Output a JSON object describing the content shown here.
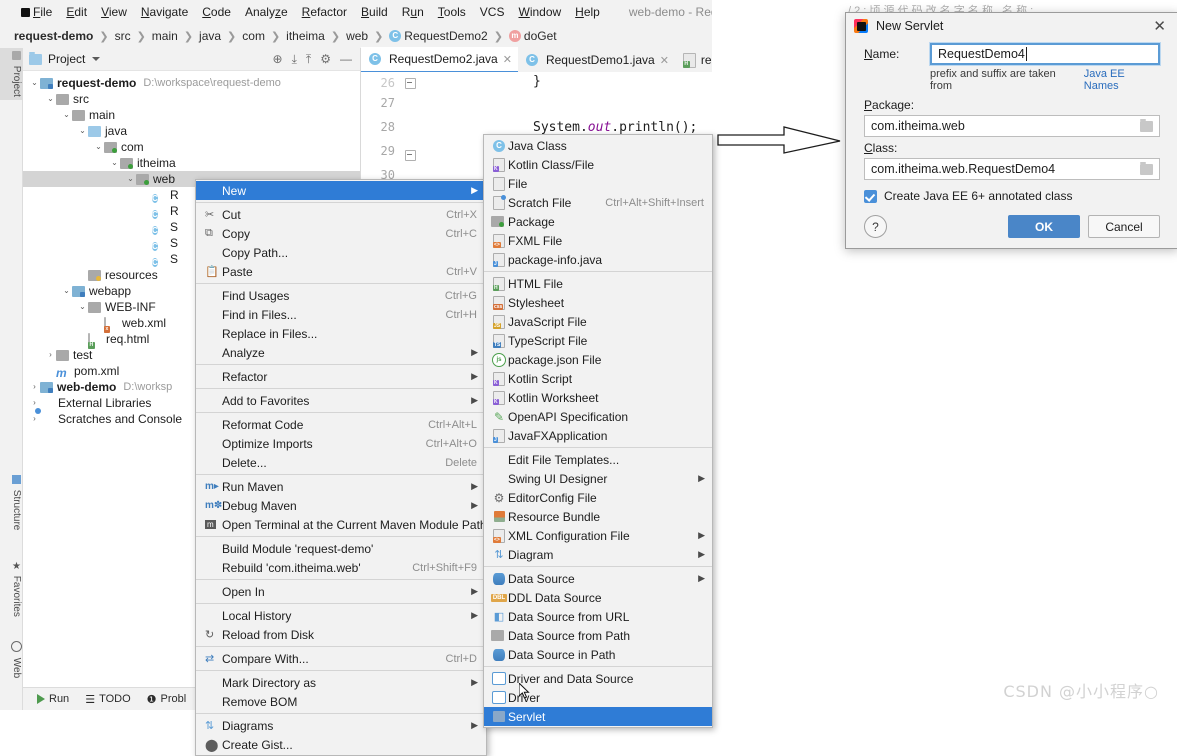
{
  "app": {
    "window_title": "web-demo - RequestDem",
    "logo_icon": "intellij-idea-logo-icon"
  },
  "menubar": {
    "items": [
      {
        "label": "File"
      },
      {
        "label": "Edit"
      },
      {
        "label": "View"
      },
      {
        "label": "Navigate"
      },
      {
        "label": "Code"
      },
      {
        "label": "Analyze"
      },
      {
        "label": "Refactor"
      },
      {
        "label": "Build"
      },
      {
        "label": "Run"
      },
      {
        "label": "Tools"
      },
      {
        "label": "VCS"
      },
      {
        "label": "Window"
      },
      {
        "label": "Help"
      }
    ]
  },
  "breadcrumb": {
    "items": [
      {
        "label": "request-demo",
        "bold": true
      },
      {
        "label": "src"
      },
      {
        "label": "main"
      },
      {
        "label": "java"
      },
      {
        "label": "com"
      },
      {
        "label": "itheima"
      },
      {
        "label": "web"
      },
      {
        "label": "RequestDemo2",
        "icon": "class-icon"
      },
      {
        "label": "doGet",
        "icon": "method-icon"
      }
    ]
  },
  "toolwindow_strip": {
    "top": [
      {
        "label": "Project",
        "icon": "project-icon"
      }
    ],
    "bottom": [
      {
        "label": "Structure",
        "icon": "structure-icon"
      },
      {
        "label": "Favorites",
        "icon": "star-icon"
      },
      {
        "label": "Web",
        "icon": "globe-icon"
      }
    ]
  },
  "project_panel": {
    "title": "Project",
    "toolbar_icons": [
      "locate-icon",
      "expand-all-icon",
      "collapse-all-icon",
      "gear-icon",
      "minimize-icon"
    ],
    "tree": [
      {
        "indent": 0,
        "arrow": "v",
        "icon": "module-folder",
        "label": "request-demo",
        "bold": true,
        "path": "D:\\workspace\\request-demo"
      },
      {
        "indent": 1,
        "arrow": "v",
        "icon": "folder",
        "label": "src"
      },
      {
        "indent": 2,
        "arrow": "v",
        "icon": "folder",
        "label": "main"
      },
      {
        "indent": 3,
        "arrow": "v",
        "icon": "source-folder",
        "label": "java"
      },
      {
        "indent": 4,
        "arrow": "v",
        "icon": "package",
        "label": "com"
      },
      {
        "indent": 5,
        "arrow": "v",
        "icon": "package",
        "label": "itheima"
      },
      {
        "indent": 6,
        "arrow": "v",
        "icon": "package",
        "label": "web",
        "selected": true
      },
      {
        "indent": 7,
        "arrow": "",
        "icon": "class",
        "label": "R"
      },
      {
        "indent": 7,
        "arrow": "",
        "icon": "class",
        "label": "R"
      },
      {
        "indent": 7,
        "arrow": "",
        "icon": "class",
        "label": "S"
      },
      {
        "indent": 7,
        "arrow": "",
        "icon": "class",
        "label": "S"
      },
      {
        "indent": 7,
        "arrow": "",
        "icon": "class",
        "label": "S"
      },
      {
        "indent": 3,
        "arrow": "",
        "icon": "resource-folder",
        "label": "resources"
      },
      {
        "indent": 2,
        "arrow": "v",
        "icon": "webapp-folder",
        "label": "webapp"
      },
      {
        "indent": 3,
        "arrow": "v",
        "icon": "folder",
        "label": "WEB-INF"
      },
      {
        "indent": 4,
        "arrow": "",
        "icon": "xml-file",
        "label": "web.xml"
      },
      {
        "indent": 3,
        "arrow": "",
        "icon": "html-file",
        "label": "req.html"
      },
      {
        "indent": 1,
        "arrow": ">",
        "icon": "folder",
        "label": "test"
      },
      {
        "indent": 1,
        "arrow": "",
        "icon": "maven-file",
        "label": "pom.xml"
      },
      {
        "indent": 0,
        "arrow": ">",
        "icon": "module-folder",
        "label": "web-demo",
        "bold": true,
        "path": "D:\\worksp"
      },
      {
        "indent": 0,
        "arrow": ">",
        "icon": "libraries",
        "label": "External Libraries"
      },
      {
        "indent": 0,
        "arrow": ">",
        "icon": "scratches",
        "label": "Scratches and Console"
      }
    ]
  },
  "editor": {
    "tabs": [
      {
        "label": "RequestDemo2.java",
        "icon": "class-icon",
        "active": true,
        "closable": true
      },
      {
        "label": "RequestDemo1.java",
        "icon": "class-icon",
        "active": false,
        "closable": true
      },
      {
        "label": "req.htm",
        "icon": "html-file-icon",
        "active": false,
        "closable": false
      }
    ],
    "line_numbers": [
      "26",
      "27",
      "28",
      "29",
      "30"
    ],
    "code_lines": [
      {
        "text": "}"
      },
      {
        "text": ""
      },
      {
        "text": "System.out.println();"
      },
      {
        "text": "}"
      },
      {
        "text": ""
      }
    ],
    "code_fragment_prefix": "System.",
    "code_fragment_italic": "out",
    "code_fragment_suffix": ".println();"
  },
  "statusbar": {
    "items": [
      {
        "label": "Run",
        "icon": "run-icon"
      },
      {
        "label": "TODO",
        "icon": "todo-icon"
      },
      {
        "label": "Probl",
        "icon": "problems-icon"
      }
    ]
  },
  "context_menu": {
    "items": [
      {
        "label": "New",
        "submenu": true,
        "highlighted": true,
        "icon": ""
      },
      {
        "sep": true
      },
      {
        "label": "Cut",
        "shortcut": "Ctrl+X",
        "icon": "scissors-icon"
      },
      {
        "label": "Copy",
        "shortcut": "Ctrl+C",
        "icon": "copy-icon"
      },
      {
        "label": "Copy Path...",
        "shortcut": "",
        "icon": ""
      },
      {
        "label": "Paste",
        "shortcut": "Ctrl+V",
        "icon": "clipboard-icon"
      },
      {
        "sep": true
      },
      {
        "label": "Find Usages",
        "shortcut": "Ctrl+G",
        "icon": ""
      },
      {
        "label": "Find in Files...",
        "shortcut": "Ctrl+H",
        "icon": ""
      },
      {
        "label": "Replace in Files...",
        "shortcut": "",
        "icon": ""
      },
      {
        "label": "Analyze",
        "submenu": true,
        "icon": ""
      },
      {
        "sep": true
      },
      {
        "label": "Refactor",
        "submenu": true,
        "icon": ""
      },
      {
        "sep": true
      },
      {
        "label": "Add to Favorites",
        "submenu": true,
        "icon": ""
      },
      {
        "sep": true
      },
      {
        "label": "Reformat Code",
        "shortcut": "Ctrl+Alt+L",
        "icon": ""
      },
      {
        "label": "Optimize Imports",
        "shortcut": "Ctrl+Alt+O",
        "icon": ""
      },
      {
        "label": "Delete...",
        "shortcut": "Delete",
        "icon": ""
      },
      {
        "sep": true
      },
      {
        "label": "Run Maven",
        "submenu": true,
        "icon": "maven-run-icon"
      },
      {
        "label": "Debug Maven",
        "submenu": true,
        "icon": "maven-debug-icon"
      },
      {
        "label": "Open Terminal at the Current Maven Module Path",
        "icon": "terminal-icon"
      },
      {
        "sep": true
      },
      {
        "label": "Build Module 'request-demo'",
        "shortcut": "",
        "icon": ""
      },
      {
        "label": "Rebuild 'com.itheima.web'",
        "shortcut": "Ctrl+Shift+F9",
        "icon": ""
      },
      {
        "sep": true
      },
      {
        "label": "Open In",
        "submenu": true,
        "icon": ""
      },
      {
        "sep": true
      },
      {
        "label": "Local History",
        "submenu": true,
        "icon": ""
      },
      {
        "label": "Reload from Disk",
        "icon": "reload-icon"
      },
      {
        "sep": true
      },
      {
        "label": "Compare With...",
        "shortcut": "Ctrl+D",
        "icon": "compare-icon"
      },
      {
        "sep": true
      },
      {
        "label": "Mark Directory as",
        "submenu": true,
        "icon": ""
      },
      {
        "label": "Remove BOM",
        "icon": ""
      },
      {
        "sep": true
      },
      {
        "label": "Diagrams",
        "submenu": true,
        "icon": "diagram-icon"
      },
      {
        "label": "Create Gist...",
        "icon": "github-icon"
      }
    ]
  },
  "new_submenu": {
    "items": [
      {
        "label": "Java Class",
        "icon": "java-class-icon"
      },
      {
        "label": "Kotlin Class/File",
        "icon": "kotlin-icon"
      },
      {
        "label": "File",
        "icon": "file-icon"
      },
      {
        "label": "Scratch File",
        "shortcut": "Ctrl+Alt+Shift+Insert",
        "icon": "scratch-file-icon"
      },
      {
        "label": "Package",
        "icon": "package-icon"
      },
      {
        "label": "FXML File",
        "icon": "fxml-file-icon"
      },
      {
        "label": "package-info.java",
        "icon": "java-file-icon"
      },
      {
        "sep": true
      },
      {
        "label": "HTML File",
        "icon": "html-file-icon"
      },
      {
        "label": "Stylesheet",
        "icon": "css-file-icon"
      },
      {
        "label": "JavaScript File",
        "icon": "js-file-icon"
      },
      {
        "label": "TypeScript File",
        "icon": "ts-file-icon"
      },
      {
        "label": "package.json File",
        "icon": "npm-icon"
      },
      {
        "label": "Kotlin Script",
        "icon": "kotlin-icon"
      },
      {
        "label": "Kotlin Worksheet",
        "icon": "kotlin-icon"
      },
      {
        "label": "OpenAPI Specification",
        "icon": "openapi-icon"
      },
      {
        "label": "JavaFXApplication",
        "icon": "java-file-icon"
      },
      {
        "sep": true
      },
      {
        "label": "Edit File Templates...",
        "icon": ""
      },
      {
        "label": "Swing UI Designer",
        "submenu": true,
        "icon": ""
      },
      {
        "label": "EditorConfig File",
        "icon": "gear-icon"
      },
      {
        "label": "Resource Bundle",
        "icon": "resource-bundle-icon"
      },
      {
        "label": "XML Configuration File",
        "submenu": true,
        "icon": "xml-file-icon"
      },
      {
        "label": "Diagram",
        "submenu": true,
        "icon": "diagram-icon"
      },
      {
        "sep": true
      },
      {
        "label": "Data Source",
        "submenu": true,
        "icon": "database-icon"
      },
      {
        "label": "DDL Data Source",
        "icon": "ddl-icon"
      },
      {
        "label": "Data Source from URL",
        "icon": "url-source-icon"
      },
      {
        "label": "Data Source from Path",
        "icon": "folder-icon"
      },
      {
        "label": "Data Source in Path",
        "icon": "database-icon"
      },
      {
        "sep": true
      },
      {
        "label": "Driver and Data Source",
        "icon": "driver-icon"
      },
      {
        "label": "Driver",
        "icon": "driver-icon"
      },
      {
        "label": "Servlet",
        "icon": "servlet-icon",
        "highlighted": true
      }
    ]
  },
  "dialog": {
    "title": "New Servlet",
    "title_icon": "intellij-idea-logo-icon",
    "close_icon": "close-icon",
    "name_label": "Name:",
    "name_value": "RequestDemo4",
    "hint_text": "prefix and suffix are taken from",
    "hint_link": "Java EE Names",
    "package_label": "Package:",
    "package_value": "com.itheima.web",
    "class_label": "Class:",
    "class_value": "com.itheima.web.RequestDemo4",
    "checkbox_label": "Create Java EE 6+ annotated class",
    "checkbox_checked": true,
    "help_label": "?",
    "ok_label": "OK",
    "cancel_label": "Cancel",
    "accent_color": "#4a86c8",
    "browse_icon": "folder-browse-icon"
  },
  "annotation": {
    "arrow_icon": "right-arrow-annotation",
    "background_text": "/ 2 :  顷 源 代 码 改 名 字 名 称 ,  名 称 :"
  },
  "watermark": {
    "text": "CSDN @小小程序○"
  }
}
